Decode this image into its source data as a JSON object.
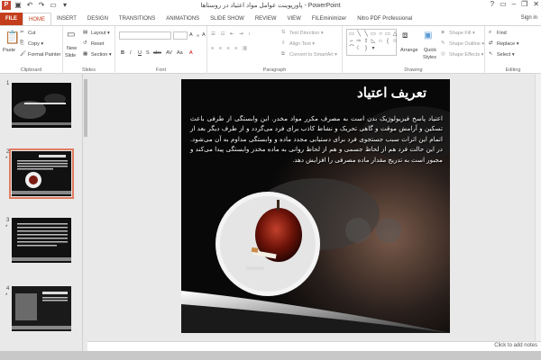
{
  "window": {
    "title": "پاورپوینت عوامل مواد اعتیاد در روستاها - PowerPoint",
    "help": "?",
    "minimize": "–",
    "restore": "❐",
    "close": "✕"
  },
  "tabs": [
    "HOME",
    "INSERT",
    "DESIGN",
    "TRANSITIONS",
    "ANIMATIONS",
    "SLIDE SHOW",
    "REVIEW",
    "VIEW",
    "FILEminimizer",
    "Nitro PDF Professional"
  ],
  "file_tab": "FILE",
  "sign_in": "Sign in",
  "ribbon": {
    "clipboard": {
      "paste": "Paste",
      "cut": "Cut",
      "copy": "Copy",
      "format_painter": "Format Painter",
      "label": "Clipboard"
    },
    "slides": {
      "new_slide_1": "New",
      "new_slide_2": "Slide",
      "layout": "Layout",
      "reset": "Reset",
      "section": "Section",
      "label": "Slides"
    },
    "font": {
      "bold": "B",
      "italic": "I",
      "underline": "U",
      "strike": "S",
      "shadow": "abc",
      "spacing": "AV",
      "case": "Aa",
      "color": "A",
      "grow": "A",
      "shrink": "A",
      "clear": "A",
      "label": "Font"
    },
    "paragraph": {
      "text_direction": "Text Direction",
      "align_text": "Align Text",
      "smartart": "Convert to SmartArt",
      "label": "Paragraph"
    },
    "drawing": {
      "arrange": "Arrange",
      "quick_styles_1": "Quick",
      "quick_styles_2": "Styles",
      "shape_fill": "Shape Fill",
      "shape_outline": "Shape Outline",
      "shape_effects": "Shape Effects",
      "label": "Drawing"
    },
    "editing": {
      "find": "Find",
      "replace": "Replace",
      "select": "Select",
      "label": "Editing"
    }
  },
  "thumbnails": [
    {
      "num": "1",
      "star": ""
    },
    {
      "num": "2",
      "star": "*"
    },
    {
      "num": "3",
      "star": "*"
    },
    {
      "num": "4",
      "star": "*"
    }
  ],
  "slide": {
    "title": "تعریف اعتیاد",
    "body": "اعتیاد پاسخ فیزیولوژیک بدن است به مصرف مکرر مواد مخدر. این وابستگی از طرفی باعث تسکین و آرامش موقت و گاهی تحریک و نشاط کاذب برای فرد می‌گردد و از طرف دیگر بعد از اتمام این اثرات سبب جستجوی فرد برای دستیابی مجدد ماده و وابستگی مداوم به آن می‌شود. در این حالت فرد هم از لحاظ جسمی و هم از لحاظ روانی به ماده مخدر وابستگی پیدا می‌کند و مجبور است به تدریج مقدار ماده مصرفی را افزایش دهد."
  },
  "notes_placeholder": "Click to add notes",
  "colors": {
    "accent": "#c43e1c",
    "selected_thumb": "#e07b61"
  }
}
